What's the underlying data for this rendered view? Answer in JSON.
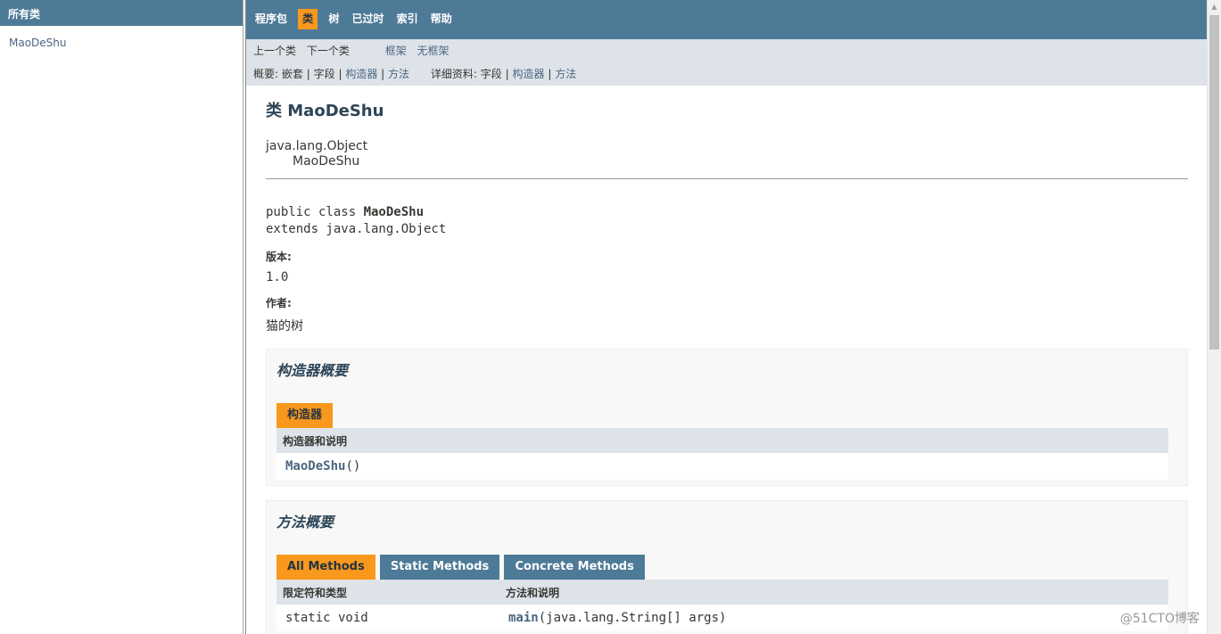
{
  "left": {
    "header": "所有类",
    "classes": [
      "MaoDeShu"
    ]
  },
  "topnav": {
    "items": [
      "程序包",
      "类",
      "树",
      "已过时",
      "索引",
      "帮助"
    ]
  },
  "subnav": {
    "prev_class": "上一个类",
    "next_class": "下一个类",
    "frames": "框架",
    "no_frames": "无框架",
    "summary_label": "概要:",
    "nested": "嵌套",
    "field": "字段",
    "constr": "构造器",
    "method": "方法",
    "detail_label": "详细资料:",
    "detail_field": "字段",
    "detail_constr": "构造器",
    "detail_method": "方法",
    "sep": "|"
  },
  "class_info": {
    "title": "类 MaoDeShu",
    "super": "java.lang.Object",
    "name": "MaoDeShu",
    "sig_prefix": "public class ",
    "sig_name": "MaoDeShu",
    "sig_extends": "extends java.lang.Object",
    "version_label": "版本:",
    "version": "1.0",
    "author_label": "作者:",
    "author": "猫的树"
  },
  "constructor_summary": {
    "heading": "构造器概要",
    "caption": "构造器",
    "col": "构造器和说明",
    "row_name": "MaoDeShu",
    "row_args": "()"
  },
  "method_summary": {
    "heading": "方法概要",
    "tabs": [
      "All Methods",
      "Static Methods",
      "Concrete Methods"
    ],
    "col1": "限定符和类型",
    "col2": "方法和说明",
    "row_type": "static void",
    "row_name": "main",
    "row_args": "(java.lang.String[] args)"
  },
  "watermark": "@51CTO博客"
}
